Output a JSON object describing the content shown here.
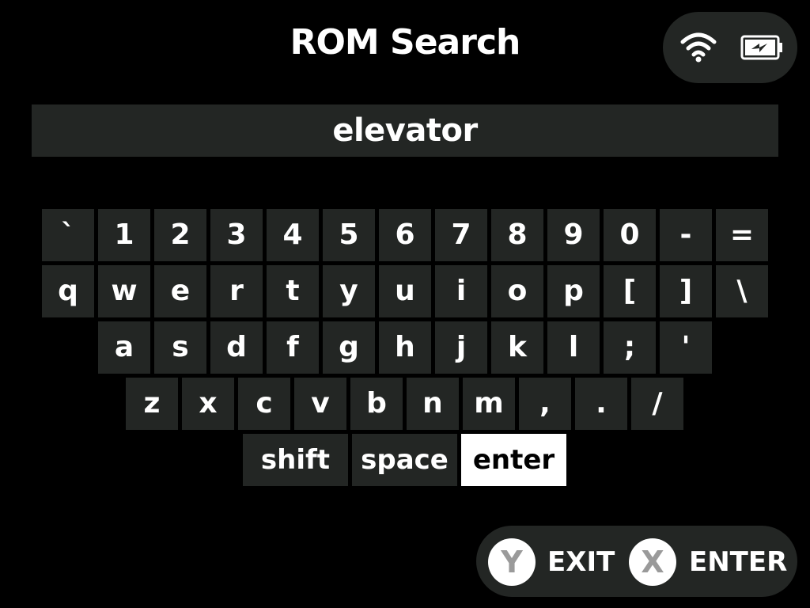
{
  "header": {
    "title": "ROM Search"
  },
  "status": {
    "wifi_icon": "wifi-icon",
    "battery_icon": "battery-charging-icon"
  },
  "search": {
    "value": "elevator"
  },
  "keyboard": {
    "row1": [
      "`",
      "1",
      "2",
      "3",
      "4",
      "5",
      "6",
      "7",
      "8",
      "9",
      "0",
      "-",
      "="
    ],
    "row2": [
      "q",
      "w",
      "e",
      "r",
      "t",
      "y",
      "u",
      "i",
      "o",
      "p",
      "[",
      "]",
      "\\"
    ],
    "row3": [
      "a",
      "s",
      "d",
      "f",
      "g",
      "h",
      "j",
      "k",
      "l",
      ";",
      "'"
    ],
    "row4": [
      "z",
      "x",
      "c",
      "v",
      "b",
      "n",
      "m",
      ",",
      ".",
      "/"
    ],
    "row5": [
      "shift",
      "space",
      "enter"
    ],
    "selected_key": "enter"
  },
  "hints": {
    "y_button": "Y",
    "y_label": "EXIT",
    "x_button": "X",
    "x_label": "ENTER"
  },
  "colors": {
    "background": "#000000",
    "key": "#232624",
    "selected_key": "#ffffff",
    "text": "#ffffff"
  }
}
